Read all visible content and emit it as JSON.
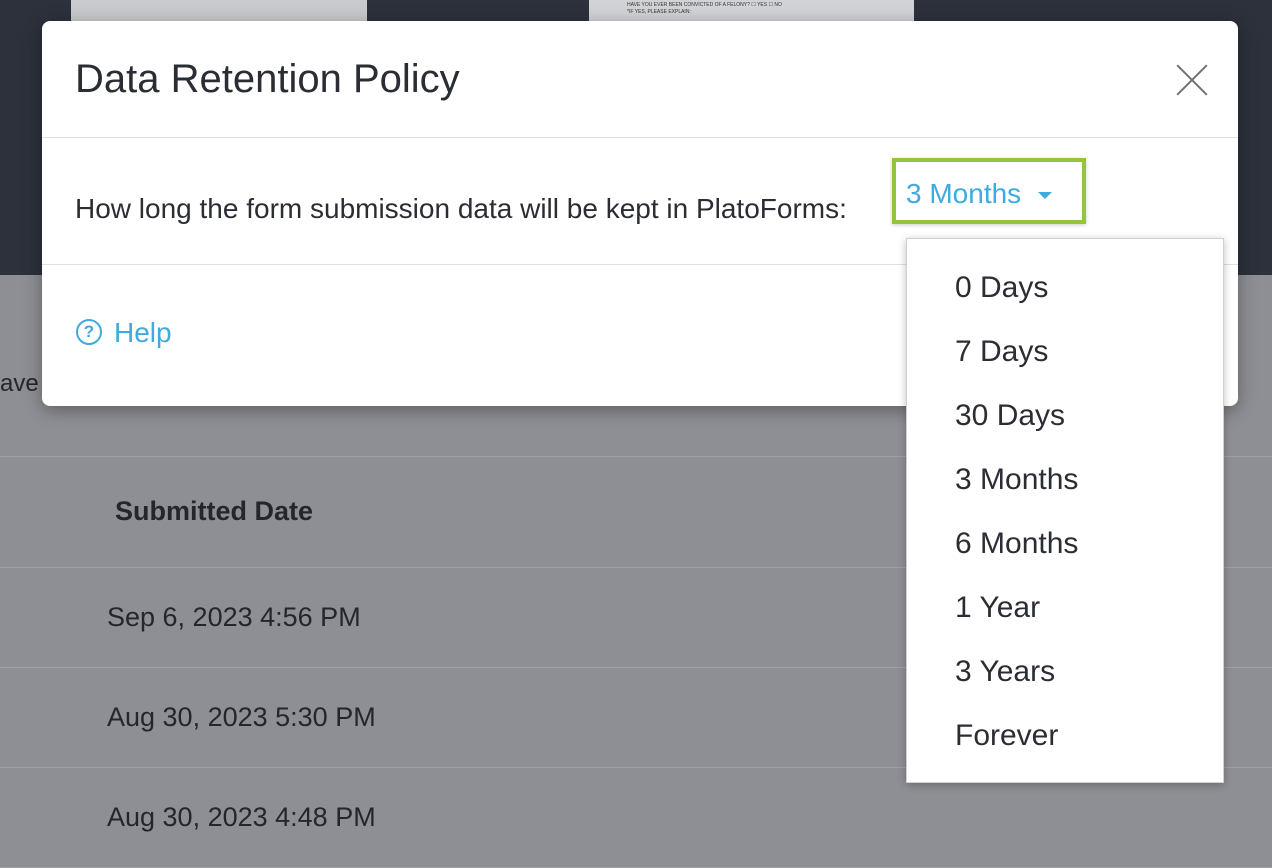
{
  "background": {
    "thumbnail_text_1": "HAVE YOU EVER BEEN CONVICTED OF A FELONY? ☐ YES ☐ NO",
    "thumbnail_text_2": "*IF YES, PLEASE EXPLAIN:",
    "partial_text": "ave",
    "table": {
      "column_header": "Submitted Date",
      "rows": [
        "Sep 6, 2023 4:56 PM",
        "Aug 30, 2023 5:30 PM",
        "Aug 30, 2023 4:48 PM"
      ]
    }
  },
  "modal": {
    "title": "Data Retention Policy",
    "close_icon": "close-icon",
    "prompt": "How long the form submission data will be kept in PlatoForms:",
    "select": {
      "value": "3 Months",
      "highlight_color": "#95c33c",
      "link_color": "#3eaadf"
    },
    "help": {
      "icon": "question-circle-icon",
      "label": "Help"
    }
  },
  "dropdown": {
    "options": [
      "0 Days",
      "7 Days",
      "30 Days",
      "3 Months",
      "6 Months",
      "1 Year",
      "3 Years",
      "Forever"
    ]
  }
}
